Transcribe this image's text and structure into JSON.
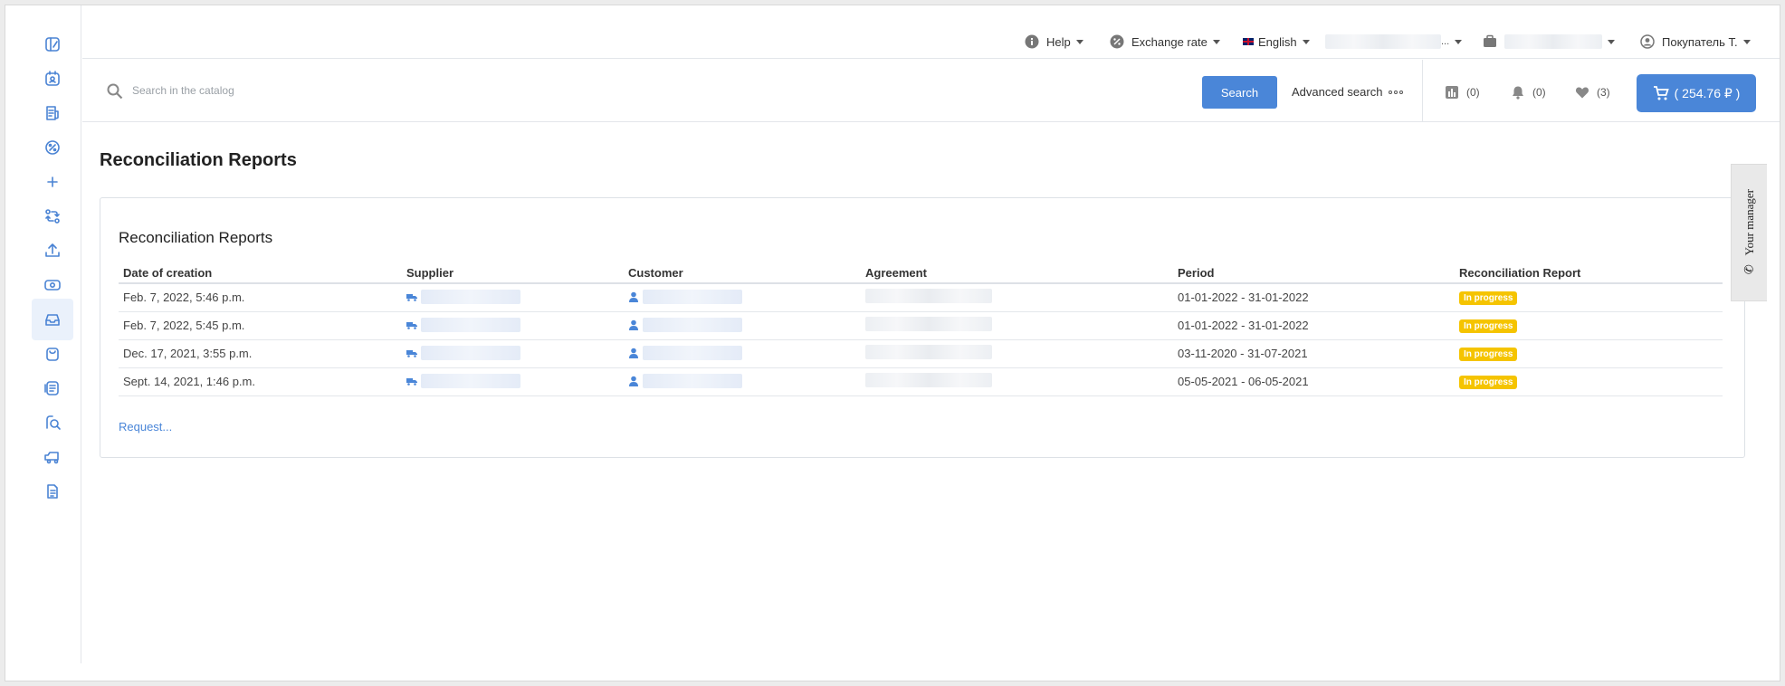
{
  "topbar": {
    "help_label": "Help",
    "exchange_label": "Exchange rate",
    "language_label": "English",
    "account_suffix": "...",
    "user_label": "Покупатель Т."
  },
  "search": {
    "placeholder": "Search in the catalog",
    "button_label": "Search",
    "advanced_label": "Advanced search",
    "compare_count": "(0)",
    "notifications_count": "(0)",
    "favorites_count": "(3)",
    "cart_label": "( 254.76 ₽ )"
  },
  "sidebar": {
    "items": [
      "catalog-icon",
      "calendar-icon",
      "invoice-icon",
      "discount-icon",
      "plus-icon",
      "exchange-icon",
      "upload-icon",
      "money-icon",
      "inbox-icon",
      "bag-icon",
      "documents-icon",
      "search-doc-icon",
      "truck-icon",
      "file-icon"
    ],
    "active_index": 8
  },
  "page": {
    "title": "Reconciliation Reports",
    "card_title": "Reconciliation Reports",
    "request_link": "Request...",
    "manager_tab": "Your manager"
  },
  "table": {
    "headers": [
      "Date of creation",
      "Supplier",
      "Customer",
      "Agreement",
      "Period",
      "Reconciliation Report"
    ],
    "rows": [
      {
        "date": "Feb. 7, 2022, 5:46 p.m.",
        "period": "01-01-2022 - 31-01-2022",
        "status": "In progress"
      },
      {
        "date": "Feb. 7, 2022, 5:45 p.m.",
        "period": "01-01-2022 - 31-01-2022",
        "status": "In progress"
      },
      {
        "date": "Dec. 17, 2021, 3:55 p.m.",
        "period": "03-11-2020 - 31-07-2021",
        "status": "In progress"
      },
      {
        "date": "Sept. 14, 2021, 1:46 p.m.",
        "period": "05-05-2021 - 06-05-2021",
        "status": "In progress"
      }
    ]
  },
  "colors": {
    "accent": "#4a86d8",
    "status_badge": "#f5c400",
    "sidebar_active_bg": "#eaf1fb"
  }
}
